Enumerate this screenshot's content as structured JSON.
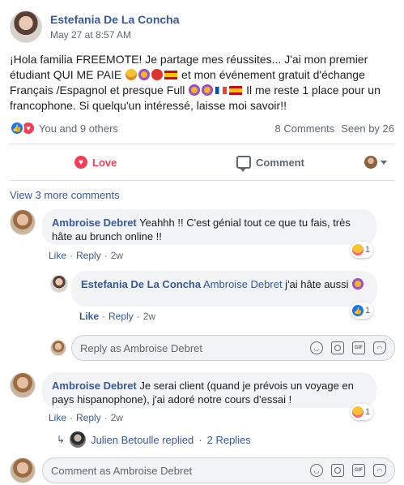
{
  "post": {
    "author": "Estefania De La Concha",
    "date": "May 27 at 8:57 AM",
    "text_1": "¡Hola familia FREEMOTE! Je partage mes réussites... J'ai mon premier étudiant QUI ME PAIE ",
    "text_2": " et mon événement gratuit d'échange Français /Espagnol et presque Full ",
    "text_3": " Il me reste 1 place pour un francophone. Si quelqu'un intéressé, laisse moi savoir!!"
  },
  "stats": {
    "reactions_text": "You and 9 others",
    "comments_count": "8 Comments",
    "seen_by": "Seen by 26"
  },
  "actions": {
    "love_label": "Love",
    "comment_label": "Comment"
  },
  "comments": {
    "view_more": "View 3 more comments",
    "c1": {
      "author": "Ambroise Debret",
      "text": "Yeahhh !! C'est génial tout ce que tu fais, très hâte au brunch online !!",
      "like": "Like",
      "reply": "Reply",
      "time": "2w",
      "reaction_count": "1"
    },
    "r1": {
      "author": "Estefania De La Concha",
      "mention": "Ambroise Debret",
      "text": " j'ai hâte aussi ",
      "like": "Like",
      "reply": "Reply",
      "time": "2w",
      "reaction_count": "1"
    },
    "reply_box_1": {
      "placeholder": "Reply as Ambroise Debret"
    },
    "c2": {
      "author": "Ambroise Debret",
      "text": "Je serai client (quand je prévois un voyage en pays hispanophone), j'ai adoré notre cours d'essai !",
      "like": "Like",
      "reply": "Reply",
      "time": "2w",
      "reaction_count": "1"
    },
    "replied": {
      "name": "Julien Betoulle replied",
      "sep": "·",
      "count": "2 Replies"
    },
    "comment_box": {
      "placeholder": "Comment as Ambroise Debret"
    }
  },
  "colors": {
    "link": "#385898",
    "love": "#f33e58",
    "like": "#1877f2",
    "muted": "#606770",
    "bubble": "#f2f3f5"
  }
}
